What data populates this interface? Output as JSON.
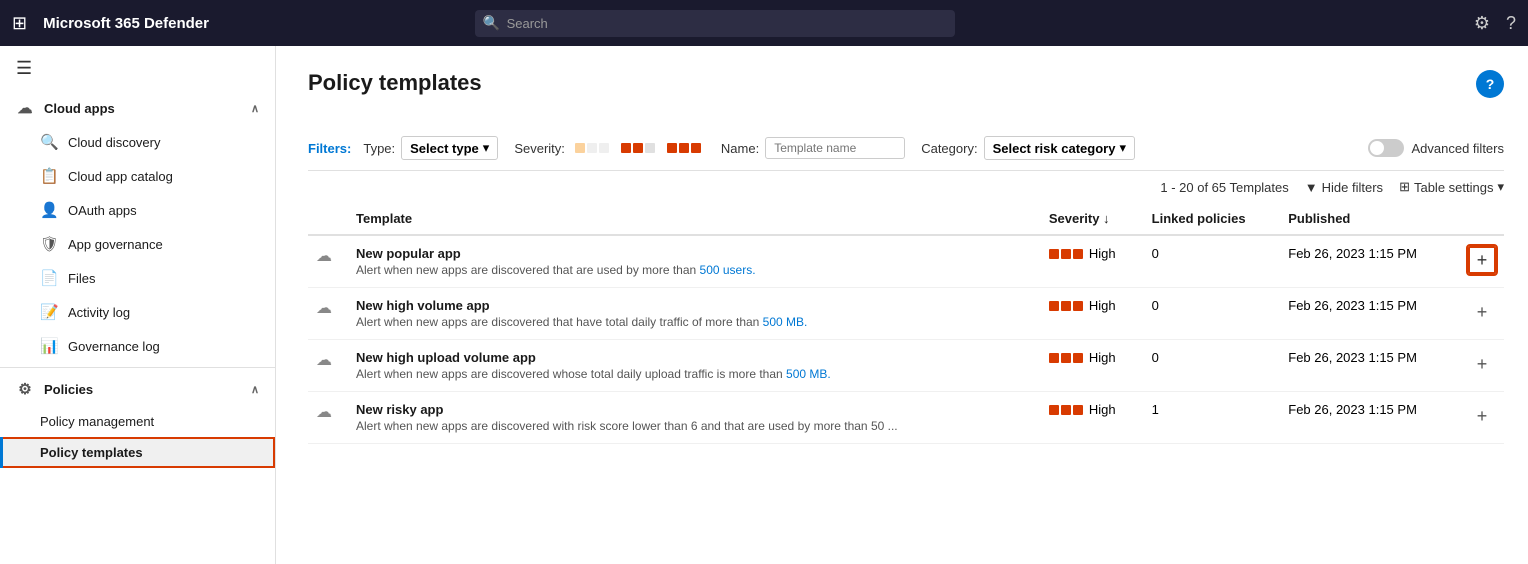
{
  "app": {
    "title": "Microsoft 365 Defender",
    "waffle_icon": "⊞",
    "search_placeholder": "Search"
  },
  "topnav": {
    "settings_label": "⚙",
    "help_label": "?"
  },
  "sidebar": {
    "hamburger": "☰",
    "sections": [
      {
        "id": "cloud-apps",
        "label": "Cloud apps",
        "icon": "☁",
        "expanded": true,
        "items": [
          {
            "id": "cloud-discovery",
            "label": "Cloud discovery",
            "icon": "🔍",
            "active": false
          },
          {
            "id": "cloud-app-catalog",
            "label": "Cloud app catalog",
            "icon": "📋",
            "active": false
          },
          {
            "id": "oauth-apps",
            "label": "OAuth apps",
            "icon": "👤",
            "active": false
          },
          {
            "id": "app-governance",
            "label": "App governance",
            "icon": "🛡",
            "active": false
          },
          {
            "id": "files",
            "label": "Files",
            "icon": "📄",
            "active": false
          },
          {
            "id": "activity-log",
            "label": "Activity log",
            "icon": "📝",
            "active": false
          },
          {
            "id": "governance-log",
            "label": "Governance log",
            "icon": "📊",
            "active": false
          }
        ]
      },
      {
        "id": "policies",
        "label": "Policies",
        "icon": "⚙",
        "expanded": true,
        "items": [
          {
            "id": "policy-management",
            "label": "Policy management",
            "icon": "",
            "active": false
          },
          {
            "id": "policy-templates",
            "label": "Policy templates",
            "icon": "",
            "active": true
          }
        ]
      }
    ]
  },
  "main": {
    "page_title": "Policy templates",
    "help_icon": "?",
    "filters": {
      "label": "Filters:",
      "type_label": "Type:",
      "type_value": "Select type",
      "severity_label": "Severity:",
      "name_label": "Name:",
      "name_placeholder": "Template name",
      "category_label": "Category:",
      "category_value": "Select risk category",
      "advanced_filters_label": "Advanced filters"
    },
    "table": {
      "count_text": "1 - 20 of 65 Templates",
      "hide_filters_label": "Hide filters",
      "table_settings_label": "Table settings",
      "columns": [
        {
          "id": "template",
          "label": "Template",
          "sortable": false
        },
        {
          "id": "severity",
          "label": "Severity",
          "sortable": true
        },
        {
          "id": "linked-policies",
          "label": "Linked policies",
          "sortable": false
        },
        {
          "id": "published",
          "label": "Published",
          "sortable": false
        },
        {
          "id": "action",
          "label": "",
          "sortable": false
        }
      ],
      "rows": [
        {
          "id": 1,
          "name": "New popular app",
          "desc_before": "Alert when new apps are discovered that are used by more than ",
          "desc_link": "500 users.",
          "desc_after": "",
          "severity": "High",
          "linked": "0",
          "published": "Feb 26, 2023 1:15 PM",
          "highlight": true
        },
        {
          "id": 2,
          "name": "New high volume app",
          "desc_before": "Alert when new apps are discovered that have total daily traffic of more than ",
          "desc_link": "500 MB.",
          "desc_after": "",
          "severity": "High",
          "linked": "0",
          "published": "Feb 26, 2023 1:15 PM",
          "highlight": false
        },
        {
          "id": 3,
          "name": "New high upload volume app",
          "desc_before": "Alert when new apps are discovered whose total daily upload traffic is more than ",
          "desc_link": "500 MB.",
          "desc_after": "",
          "severity": "High",
          "linked": "0",
          "published": "Feb 26, 2023 1:15 PM",
          "highlight": false
        },
        {
          "id": 4,
          "name": "New risky app",
          "desc_before": "Alert when new apps are discovered with risk score lower than 6 and that are used by more than 50 ...",
          "desc_link": "",
          "desc_after": "",
          "severity": "High",
          "linked": "1",
          "published": "Feb 26, 2023 1:15 PM",
          "highlight": false
        }
      ]
    }
  }
}
